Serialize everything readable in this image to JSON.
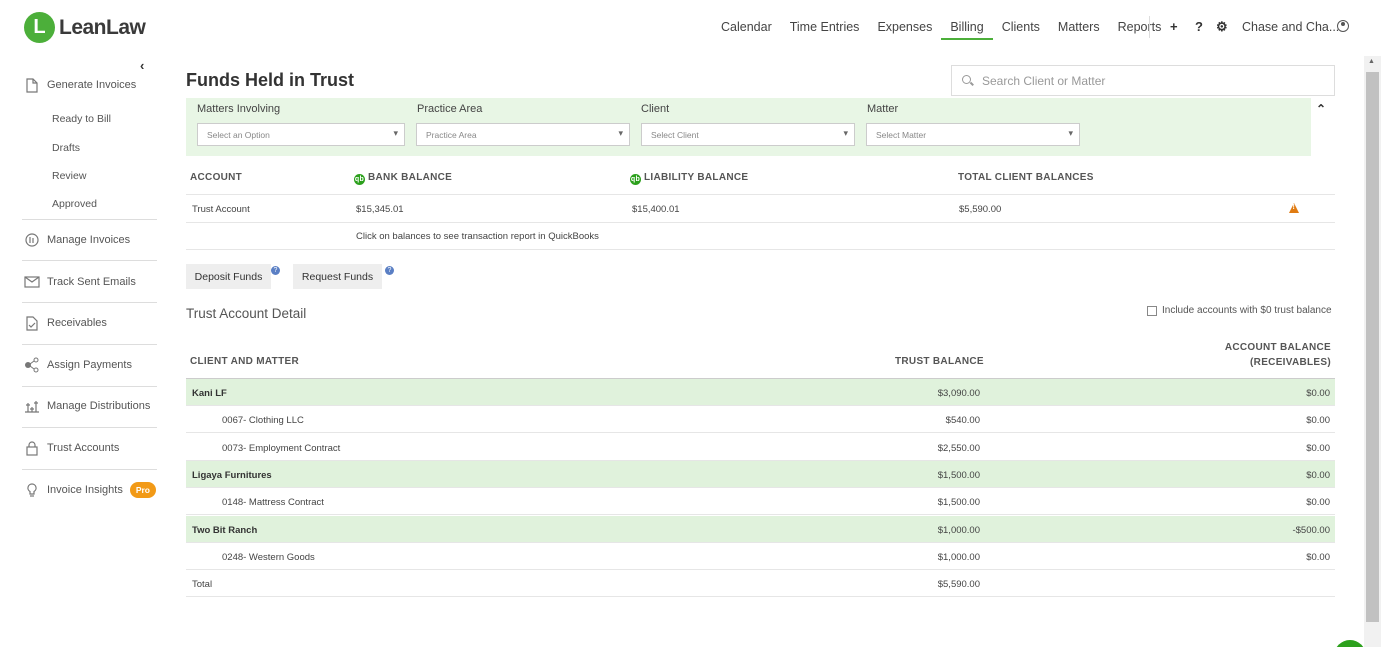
{
  "brand": {
    "logo_letter": "L",
    "name": "LeanLaw",
    "accent": "#4caf3a"
  },
  "topnav": {
    "items": [
      "Calendar",
      "Time Entries",
      "Expenses",
      "Billing",
      "Clients",
      "Matters",
      "Reports"
    ],
    "active": "Billing",
    "plus_icon": "+",
    "help_icon": "?",
    "settings_icon": "⚙",
    "user_name": "Chase and Cha..."
  },
  "sidebar": {
    "collapse_icon": "‹",
    "generate_invoices": "Generate Invoices",
    "sub_items": [
      "Ready to Bill",
      "Drafts",
      "Review",
      "Approved"
    ],
    "items": [
      {
        "label": "Manage Invoices",
        "icon": "invoice-icon"
      },
      {
        "label": "Track Sent Emails",
        "icon": "email-icon"
      },
      {
        "label": "Receivables",
        "icon": "receivables-icon"
      },
      {
        "label": "Assign Payments",
        "icon": "payments-icon"
      },
      {
        "label": "Manage Distributions",
        "icon": "distributions-icon"
      },
      {
        "label": "Trust Accounts",
        "icon": "lock-icon"
      },
      {
        "label": "Invoice Insights",
        "icon": "lightbulb-icon",
        "badge": "Pro"
      }
    ]
  },
  "page": {
    "title": "Funds Held in Trust",
    "search_placeholder": "Search Client or Matter"
  },
  "filters": {
    "matters_involving": {
      "label": "Matters Involving",
      "placeholder": "Select an Option"
    },
    "practice_area": {
      "label": "Practice Area",
      "placeholder": "Practice Area"
    },
    "client": {
      "label": "Client",
      "placeholder": "Select Client"
    },
    "matter": {
      "label": "Matter",
      "placeholder": "Select Matter"
    }
  },
  "accounts": {
    "headers": {
      "account": "ACCOUNT",
      "bank_balance": "BANK BALANCE",
      "liability_balance": "LIABILITY BALANCE",
      "total_client_balances": "TOTAL CLIENT BALANCES"
    },
    "qb_icon": "qb",
    "row": {
      "account": "Trust Account",
      "bank_balance": "$15,345.01",
      "liability_balance": "$15,400.01",
      "total_client_balances": "$5,590.00"
    },
    "note": "Click on balances to see transaction report in QuickBooks"
  },
  "actions": {
    "deposit": "Deposit Funds",
    "request": "Request Funds",
    "help_icon": "?"
  },
  "detail": {
    "title": "Trust Account Detail",
    "include_zero_label": "Include accounts with $0 trust balance",
    "headers": {
      "client_matter": "CLIENT AND MATTER",
      "trust_balance": "TRUST BALANCE",
      "account_balance_1": "ACCOUNT BALANCE",
      "account_balance_2": "(RECEIVABLES)"
    },
    "rows": [
      {
        "name": "Kani LF",
        "trust": "$3,090.00",
        "account": "$0.00",
        "group": true
      },
      {
        "name": "0067- Clothing LLC",
        "trust": "$540.00",
        "account": "$0.00",
        "group": false
      },
      {
        "name": "0073- Employment Contract",
        "trust": "$2,550.00",
        "account": "$0.00",
        "group": false
      },
      {
        "name": "Ligaya Furnitures",
        "trust": "$1,500.00",
        "account": "$0.00",
        "group": true
      },
      {
        "name": "0148- Mattress Contract",
        "trust": "$1,500.00",
        "account": "$0.00",
        "group": false
      },
      {
        "name": "Two Bit Ranch",
        "trust": "$1,000.00",
        "account": "-$500.00",
        "group": true
      },
      {
        "name": "0248- Western Goods",
        "trust": "$1,000.00",
        "account": "$0.00",
        "group": false
      },
      {
        "name": "Total",
        "trust": "$5,590.00",
        "account": "",
        "group": false
      }
    ]
  }
}
